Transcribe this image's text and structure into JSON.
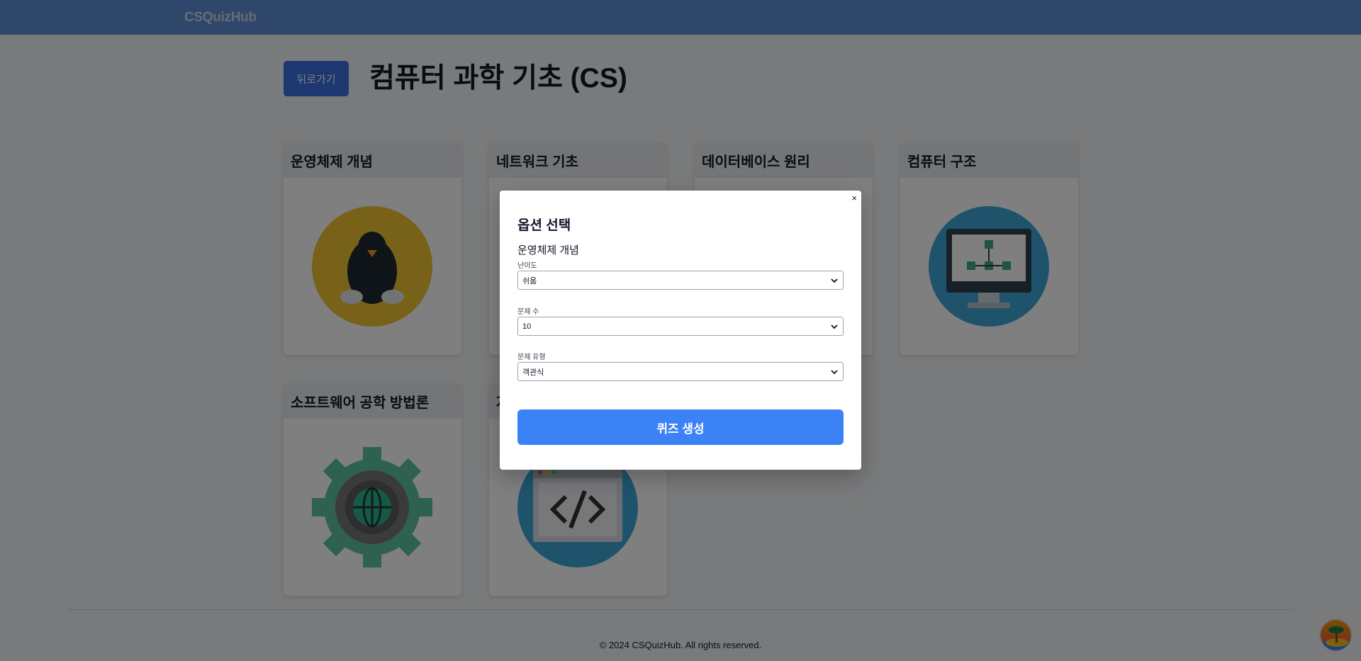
{
  "navbar": {
    "brand": "CSQuizHub"
  },
  "page": {
    "back_label": "뒤로가기",
    "title": "컴퓨터 과학 기초 (CS)"
  },
  "cards": [
    {
      "title": "운영체제 개념",
      "icon": "penguin-icon"
    },
    {
      "title": "네트워크 기초",
      "icon": "network-icon"
    },
    {
      "title": "데이터베이스 원리",
      "icon": "database-icon"
    },
    {
      "title": "컴퓨터 구조",
      "icon": "computer-icon"
    },
    {
      "title": "소프트웨어 공학 방법론",
      "icon": "gear-globe-icon"
    },
    {
      "title": "자",
      "icon": "code-window-icon"
    }
  ],
  "modal": {
    "title": "옵션 선택",
    "subject": "운영체제 개념",
    "difficulty_label": "난이도",
    "difficulty_value": "쉬움",
    "count_label": "문제 수",
    "count_value": "10",
    "type_label": "문제 유형",
    "type_value": "객관식",
    "close_symbol": "×",
    "generate_label": "퀴즈 생성"
  },
  "footer": {
    "text": "© 2024 CSQuizHub. All rights reserved."
  },
  "colors": {
    "navbar": "#5f8fd6",
    "primary_button": "#3b82f6",
    "back_button": "#3b6fe0"
  }
}
